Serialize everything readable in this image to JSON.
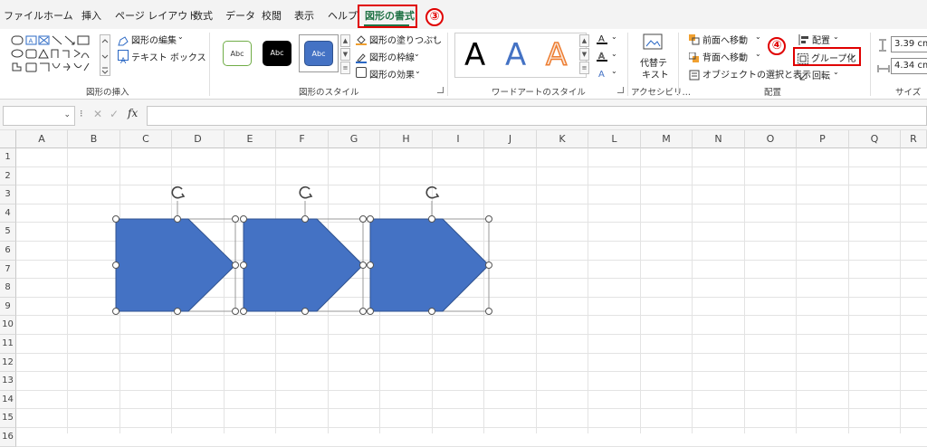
{
  "tabs": [
    "ファイル",
    "ホーム",
    "挿入",
    "ページ レイアウト",
    "数式",
    "データ",
    "校閲",
    "表示",
    "ヘルプ",
    "図形の書式"
  ],
  "step_markers": {
    "step3": "③",
    "step4": "④"
  },
  "ribbon": {
    "insert_shapes": {
      "edit_shape": "図形の編集",
      "text_box": "テキスト ボックス",
      "label": "図形の挿入"
    },
    "shape_styles": {
      "style_swatches": [
        "Abc",
        "Abc",
        "Abc"
      ],
      "fill": "図形の塗りつぶし",
      "outline": "図形の枠線",
      "effects": "図形の効果",
      "label": "図形のスタイル"
    },
    "wordart": {
      "samples": [
        "A",
        "A",
        "A"
      ],
      "label": "ワードアートのスタイル"
    },
    "accessibility": {
      "alt_text_line1": "代替テ",
      "alt_text_line2": "キスト",
      "label": "アクセシビリ…"
    },
    "arrange": {
      "bring_forward": "前面へ移動",
      "send_backward": "背面へ移動",
      "selection_pane": "オブジェクトの選択と表示",
      "align": "配置",
      "group": "グループ化",
      "rotate": "回転",
      "label": "配置"
    },
    "size": {
      "height": "3.39 cm",
      "width": "4.34 cm",
      "label": "サイズ"
    }
  },
  "formula_bar": {
    "fx": "fx",
    "cancel": "✕",
    "enter": "✓"
  },
  "columns": [
    "A",
    "B",
    "C",
    "D",
    "E",
    "F",
    "G",
    "H",
    "I",
    "J",
    "K",
    "L",
    "M",
    "N",
    "O",
    "P",
    "Q",
    "R"
  ],
  "rows": [
    "1",
    "2",
    "3",
    "4",
    "5",
    "6",
    "7",
    "8",
    "9",
    "10",
    "11",
    "12",
    "13",
    "14",
    "15",
    "16"
  ],
  "colors": {
    "accent_green": "#217346",
    "shape_fill": "#4472c4",
    "marker_red": "#e00000"
  }
}
